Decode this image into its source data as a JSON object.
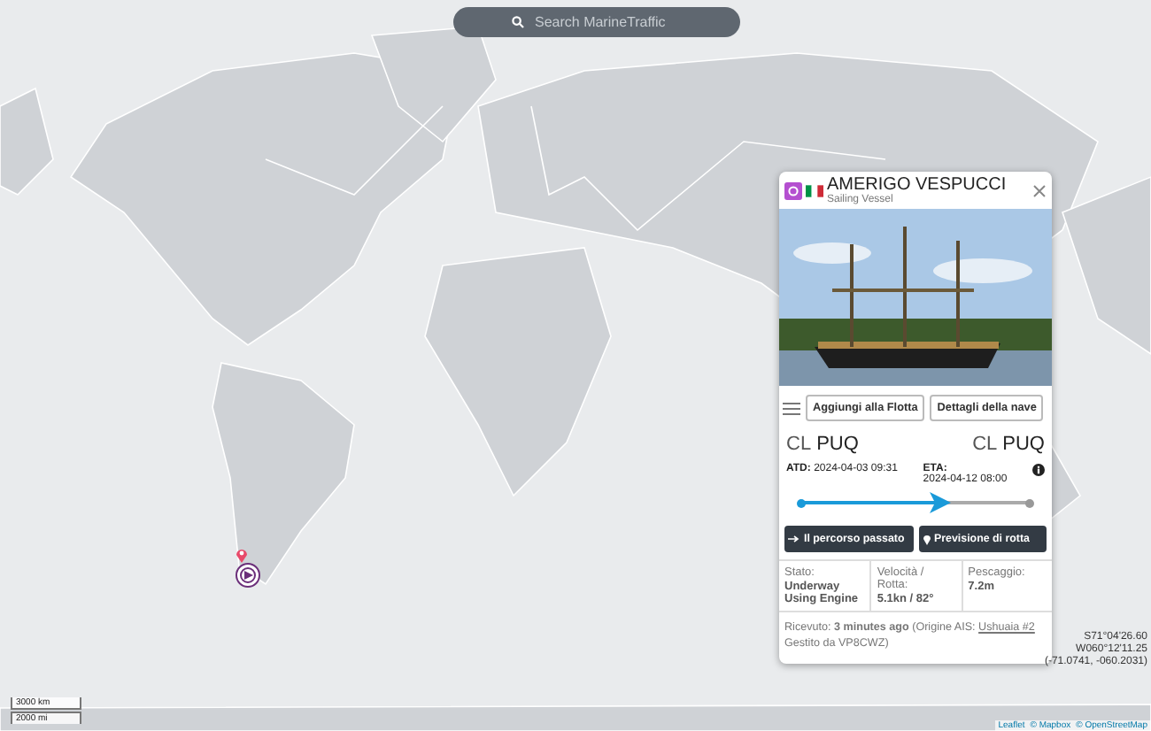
{
  "search": {
    "placeholder": "Search MarineTraffic"
  },
  "vessel": {
    "name": "AMERIGO VESPUCCI",
    "type": "Sailing Vessel"
  },
  "actions": [
    "Aggiungi alla Flotta",
    "Dettagli della nave"
  ],
  "voyage": {
    "from": {
      "country": "CL",
      "port": "PUQ"
    },
    "to": {
      "country": "CL",
      "port": "PUQ"
    },
    "atd_label": "ATD:",
    "atd": "2024-04-03 09:31",
    "eta_label": "ETA:",
    "eta": "2024-04-12 08:00",
    "level": 0.64
  },
  "route_buttons": [
    "Il percorso passato",
    "Previsione di rotta"
  ],
  "stats": [
    {
      "label": "Stato:",
      "value": "Underway Using Engine"
    },
    {
      "label": "Velocità / Rotta:",
      "value": "5.1kn / 82°"
    },
    {
      "label": "Pescaggio:",
      "value": "7.2m"
    }
  ],
  "received": {
    "before": "Ricevuto: **3 minutes ago** (Origine AIS: ",
    "link": "Ushuaia #2",
    "after": " Gestito da VP8CWZ)"
  },
  "coordinates": [
    "S71°04'26.60",
    "W060°12'11.25",
    "(-71.0741, -060.2031)"
  ],
  "scale": [
    "3000 km",
    "2000 mi"
  ],
  "attribution": [
    "Leaflet",
    "© Mapbox",
    "© OpenStreetMap"
  ]
}
